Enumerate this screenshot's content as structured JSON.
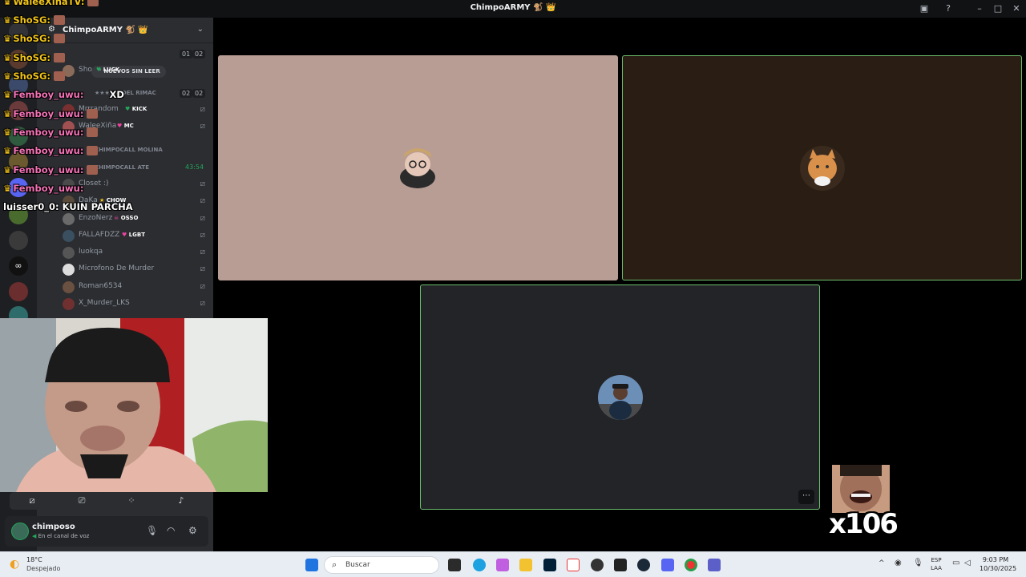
{
  "window": {
    "title": "ChimpoARMY 🐒 👑"
  },
  "server": {
    "name": "ChimpoARMY 🐒 👑"
  },
  "unread": {
    "label": "NUEVOS SIN LEER"
  },
  "channels": [
    {
      "name": "★★★★★ DEL RIMAC",
      "badges": [
        "02",
        "02"
      ]
    },
    {
      "name": "CHIMPOCALL MOLINA"
    },
    {
      "name": "CHIMPOCALL ATE",
      "timer": "43:54"
    }
  ],
  "top_badges": [
    "01",
    "02"
  ],
  "voice_users": [
    {
      "name": "Sho",
      "tag": "LUCK",
      "tag_color": "#23a55a"
    },
    {
      "name": "Mrrrandom",
      "tag": "KICK",
      "tag_color": "#23a55a"
    },
    {
      "name": "WaleeXiña",
      "tag": "MC",
      "tag_color": "#eb459e"
    },
    {
      "name": "Closet :)",
      "tag": ""
    },
    {
      "name": "DaKa",
      "tag": "CHOW",
      "tag_color": "#f5c518"
    },
    {
      "name": "EnzoNerz",
      "tag": "OSSO",
      "tag_color": "#eb459e"
    },
    {
      "name": "FALLAFDZZ",
      "tag": "LGBT",
      "tag_color": "#eb459e"
    },
    {
      "name": "luokqa",
      "tag": ""
    },
    {
      "name": "Microfono De Murder",
      "tag": ""
    },
    {
      "name": "Roman6534",
      "tag": ""
    },
    {
      "name": "X_Murder_LKS",
      "tag": ""
    }
  ],
  "chat": [
    {
      "user": "WaleeXiñaTV:",
      "color": "#f0c419",
      "text": ""
    },
    {
      "user": "ShoSG:",
      "color": "#f0c419",
      "text": ""
    },
    {
      "user": "ShoSG:",
      "color": "#f0c419",
      "text": ""
    },
    {
      "user": "ShoSG:",
      "color": "#f0c419",
      "text": ""
    },
    {
      "user": "ShoSG:",
      "color": "#f0c419",
      "text": ""
    },
    {
      "user": "Femboy_uwu:",
      "color": "#f472b6",
      "text": "XD"
    },
    {
      "user": "Femboy_uwu:",
      "color": "#f472b6",
      "text": ""
    },
    {
      "user": "Femboy_uwu:",
      "color": "#f472b6",
      "text": ""
    },
    {
      "user": "Femboy_uwu:",
      "color": "#f472b6",
      "text": ""
    },
    {
      "user": "Femboy_uwu:",
      "color": "#f472b6",
      "text": ""
    },
    {
      "user": "Femboy_uwu:",
      "color": "#f472b6",
      "text": ""
    },
    {
      "user": "luisser0_0:",
      "color": "#ffffff",
      "text": "KUIN PARCHA"
    }
  ],
  "current_user": {
    "name": "chimposo",
    "status": "En el canal de voz"
  },
  "overlay": {
    "counter": "x106"
  },
  "taskbar": {
    "weather_temp": "18°C",
    "weather_desc": "Despejado",
    "search_placeholder": "Buscar",
    "lang_line1": "ESP",
    "lang_line2": "LAA",
    "time": "9:03 PM",
    "date": "10/30/2025"
  },
  "colors": {
    "accent_green": "#23a55a",
    "tile1_bg": "#b89d94",
    "tile2_bg": "#2a1d13",
    "tile3_bg": "#232428"
  }
}
